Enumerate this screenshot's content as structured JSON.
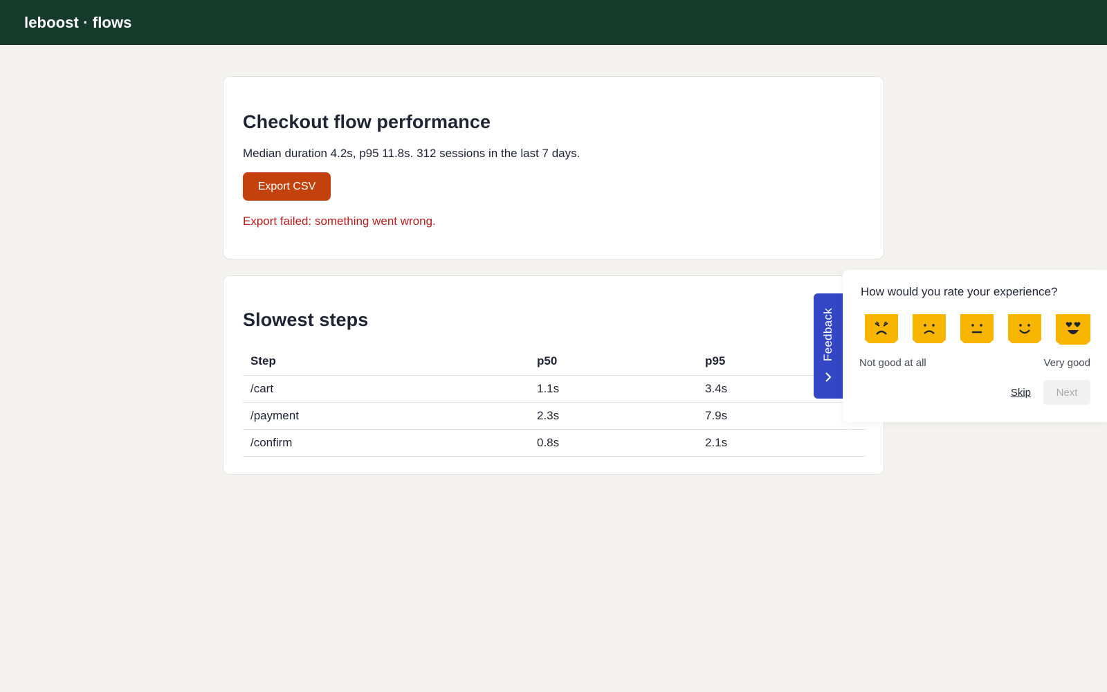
{
  "header": {
    "brand": "leboost · flows"
  },
  "performance": {
    "title": "Checkout flow performance",
    "summary": "Median duration 4.2s, p95 11.8s. 312 sessions in the last 7 days.",
    "export_label": "Export CSV",
    "error": "Export failed: something went wrong.",
    "accent_color": "#c2410c",
    "error_color": "#b91c1c"
  },
  "steps": {
    "title": "Slowest steps",
    "columns": [
      "Step",
      "p50",
      "p95"
    ],
    "rows": [
      [
        "/cart",
        "1.1s",
        "3.4s"
      ],
      [
        "/payment",
        "2.3s",
        "7.9s"
      ],
      [
        "/confirm",
        "0.8s",
        "2.1s"
      ]
    ]
  },
  "feedback": {
    "tab_label": "Feedback",
    "tab_icon": "chevron-right-icon",
    "tab_color": "#3347c4",
    "question": "How would you rate your experience?",
    "faces": [
      "angry-face-icon",
      "sad-face-icon",
      "neutral-face-icon",
      "smile-face-icon",
      "love-face-icon"
    ],
    "face_color": "#f7b500",
    "low_label": "Not good at all",
    "high_label": "Very good",
    "skip_label": "Skip",
    "next_label": "Next"
  }
}
